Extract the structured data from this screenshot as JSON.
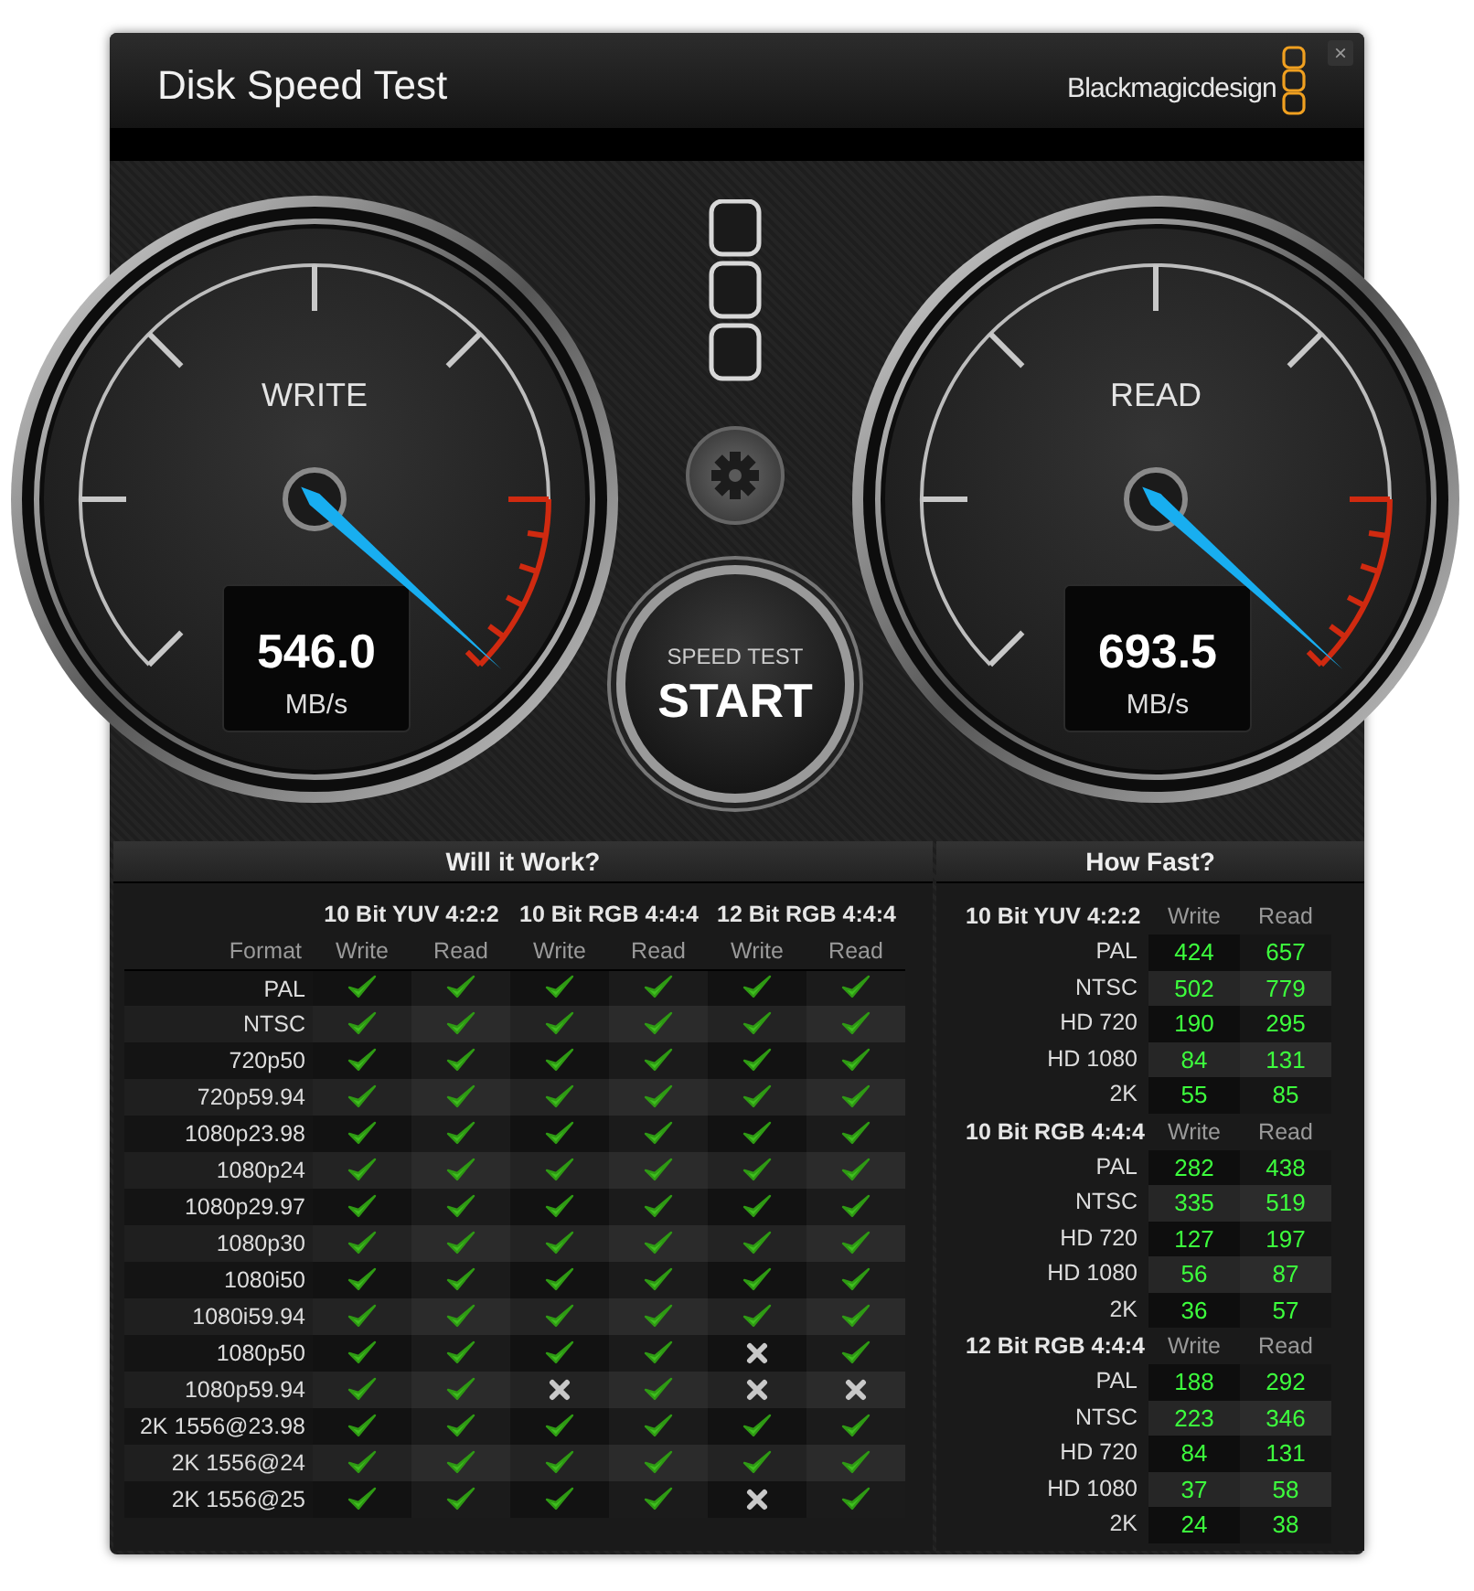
{
  "window": {
    "title": "Disk Speed Test",
    "brand": "Blackmagicdesign",
    "close": "×"
  },
  "gauges": [
    {
      "label": "WRITE",
      "value": "546.0",
      "unit": "MB/s",
      "level": 0.99
    },
    {
      "label": "READ",
      "value": "693.5",
      "unit": "MB/s",
      "level": 0.99
    }
  ],
  "start_button": {
    "caption": "SPEED TEST",
    "label": "START"
  },
  "will_it_work": {
    "title": "Will it Work?",
    "format_heading": "Format",
    "groups": [
      {
        "name": "10 Bit YUV 4:2:2",
        "columns": [
          "Write",
          "Read"
        ]
      },
      {
        "name": "10 Bit RGB 4:4:4",
        "columns": [
          "Write",
          "Read"
        ]
      },
      {
        "name": "12 Bit RGB 4:4:4",
        "columns": [
          "Write",
          "Read"
        ]
      }
    ],
    "rows": [
      {
        "format": "PAL",
        "results": [
          true,
          true,
          true,
          true,
          true,
          true
        ]
      },
      {
        "format": "NTSC",
        "results": [
          true,
          true,
          true,
          true,
          true,
          true
        ]
      },
      {
        "format": "720p50",
        "results": [
          true,
          true,
          true,
          true,
          true,
          true
        ]
      },
      {
        "format": "720p59.94",
        "results": [
          true,
          true,
          true,
          true,
          true,
          true
        ]
      },
      {
        "format": "1080p23.98",
        "results": [
          true,
          true,
          true,
          true,
          true,
          true
        ]
      },
      {
        "format": "1080p24",
        "results": [
          true,
          true,
          true,
          true,
          true,
          true
        ]
      },
      {
        "format": "1080p29.97",
        "results": [
          true,
          true,
          true,
          true,
          true,
          true
        ]
      },
      {
        "format": "1080p30",
        "results": [
          true,
          true,
          true,
          true,
          true,
          true
        ]
      },
      {
        "format": "1080i50",
        "results": [
          true,
          true,
          true,
          true,
          true,
          true
        ]
      },
      {
        "format": "1080i59.94",
        "results": [
          true,
          true,
          true,
          true,
          true,
          true
        ]
      },
      {
        "format": "1080p50",
        "results": [
          true,
          true,
          true,
          true,
          false,
          true
        ]
      },
      {
        "format": "1080p59.94",
        "results": [
          true,
          true,
          false,
          true,
          false,
          false
        ]
      },
      {
        "format": "2K 1556@23.98",
        "results": [
          true,
          true,
          true,
          true,
          true,
          true
        ]
      },
      {
        "format": "2K 1556@24",
        "results": [
          true,
          true,
          true,
          true,
          true,
          true
        ]
      },
      {
        "format": "2K 1556@25",
        "results": [
          true,
          true,
          true,
          true,
          false,
          true
        ]
      }
    ]
  },
  "how_fast": {
    "title": "How Fast?",
    "groups": [
      {
        "name": "10 Bit YUV 4:2:2",
        "columns": [
          "Write",
          "Read"
        ],
        "rows": [
          {
            "format": "PAL",
            "write": "424",
            "read": "657"
          },
          {
            "format": "NTSC",
            "write": "502",
            "read": "779"
          },
          {
            "format": "HD 720",
            "write": "190",
            "read": "295"
          },
          {
            "format": "HD 1080",
            "write": "84",
            "read": "131"
          },
          {
            "format": "2K",
            "write": "55",
            "read": "85"
          }
        ]
      },
      {
        "name": "10 Bit RGB 4:4:4",
        "columns": [
          "Write",
          "Read"
        ],
        "rows": [
          {
            "format": "PAL",
            "write": "282",
            "read": "438"
          },
          {
            "format": "NTSC",
            "write": "335",
            "read": "519"
          },
          {
            "format": "HD 720",
            "write": "127",
            "read": "197"
          },
          {
            "format": "HD 1080",
            "write": "56",
            "read": "87"
          },
          {
            "format": "2K",
            "write": "36",
            "read": "57"
          }
        ]
      },
      {
        "name": "12 Bit RGB 4:4:4",
        "columns": [
          "Write",
          "Read"
        ],
        "rows": [
          {
            "format": "PAL",
            "write": "188",
            "read": "292"
          },
          {
            "format": "NTSC",
            "write": "223",
            "read": "346"
          },
          {
            "format": "HD 720",
            "write": "84",
            "read": "131"
          },
          {
            "format": "HD 1080",
            "write": "37",
            "read": "58"
          },
          {
            "format": "2K",
            "write": "24",
            "read": "38"
          }
        ]
      }
    ]
  }
}
